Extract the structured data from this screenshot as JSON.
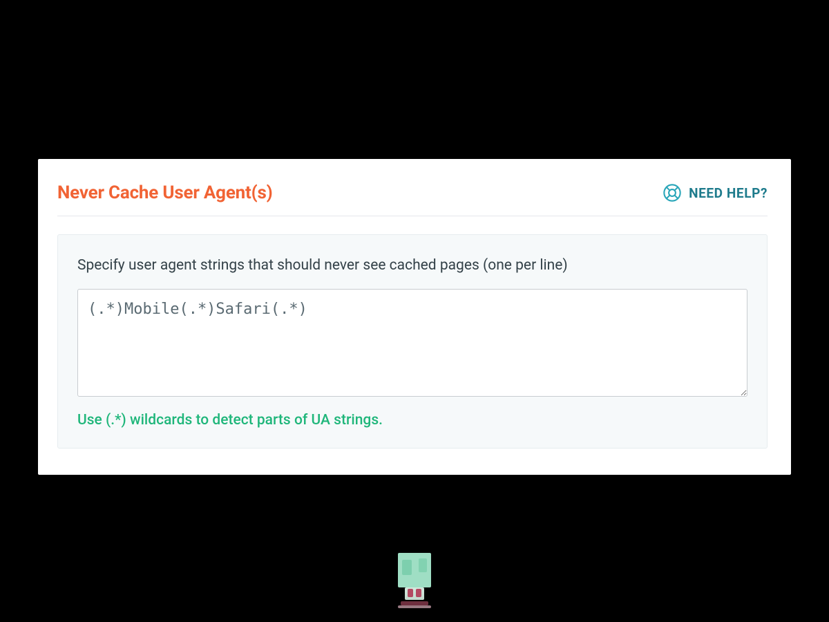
{
  "section": {
    "title": "Never Cache User Agent(s)",
    "help_label": "NEED HELP?"
  },
  "field": {
    "label": "Specify user agent strings that should never see cached pages (one per line)",
    "value": "(.*)Mobile(.*)Safari(.*)",
    "hint": "Use (.*) wildcards to detect parts of UA strings."
  }
}
